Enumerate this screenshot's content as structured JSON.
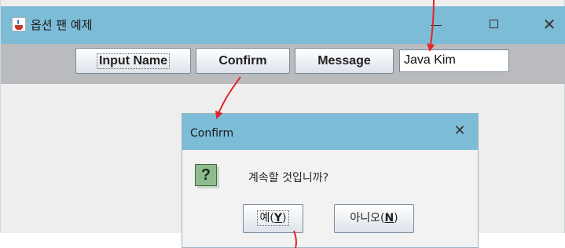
{
  "window": {
    "title": "옵션 팬 예제",
    "controls": {
      "minimize": "–",
      "maximize": "□",
      "close": "✕"
    }
  },
  "toolbar": {
    "input_name_label": "Input Name",
    "confirm_label": "Confirm",
    "message_label": "Message",
    "name_field_value": "Java Kim"
  },
  "dialog": {
    "title": "Confirm",
    "close": "✕",
    "icon_glyph": "?",
    "message": "계속할 것입니까?",
    "yes_text": "예(",
    "yes_mnemonic": "Y",
    "yes_end": ")",
    "no_text": "아니오(",
    "no_mnemonic": "N",
    "no_end": ")"
  },
  "icons": [
    "java-app-icon",
    "question-icon",
    "close-icon"
  ],
  "colors": {
    "titlebar": "#7dbcd6",
    "toolbar": "#b9bbbe",
    "arrow": "#e0262a",
    "question_icon": "#8fbc8f"
  }
}
